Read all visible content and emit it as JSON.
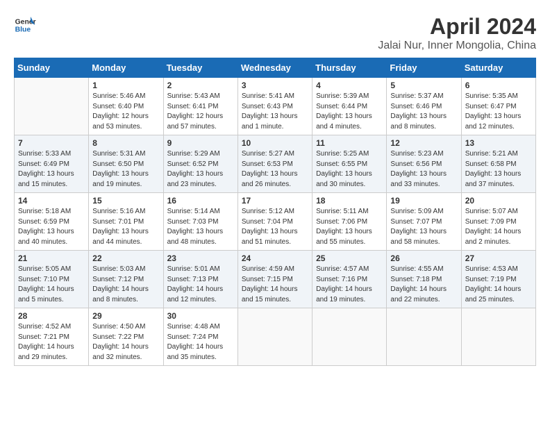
{
  "header": {
    "logo_line1": "General",
    "logo_line2": "Blue",
    "title": "April 2024",
    "subtitle": "Jalai Nur, Inner Mongolia, China"
  },
  "days_of_week": [
    "Sunday",
    "Monday",
    "Tuesday",
    "Wednesday",
    "Thursday",
    "Friday",
    "Saturday"
  ],
  "weeks": [
    [
      {
        "day": "",
        "info": ""
      },
      {
        "day": "1",
        "info": "Sunrise: 5:46 AM\nSunset: 6:40 PM\nDaylight: 12 hours\nand 53 minutes."
      },
      {
        "day": "2",
        "info": "Sunrise: 5:43 AM\nSunset: 6:41 PM\nDaylight: 12 hours\nand 57 minutes."
      },
      {
        "day": "3",
        "info": "Sunrise: 5:41 AM\nSunset: 6:43 PM\nDaylight: 13 hours\nand 1 minute."
      },
      {
        "day": "4",
        "info": "Sunrise: 5:39 AM\nSunset: 6:44 PM\nDaylight: 13 hours\nand 4 minutes."
      },
      {
        "day": "5",
        "info": "Sunrise: 5:37 AM\nSunset: 6:46 PM\nDaylight: 13 hours\nand 8 minutes."
      },
      {
        "day": "6",
        "info": "Sunrise: 5:35 AM\nSunset: 6:47 PM\nDaylight: 13 hours\nand 12 minutes."
      }
    ],
    [
      {
        "day": "7",
        "info": "Sunrise: 5:33 AM\nSunset: 6:49 PM\nDaylight: 13 hours\nand 15 minutes."
      },
      {
        "day": "8",
        "info": "Sunrise: 5:31 AM\nSunset: 6:50 PM\nDaylight: 13 hours\nand 19 minutes."
      },
      {
        "day": "9",
        "info": "Sunrise: 5:29 AM\nSunset: 6:52 PM\nDaylight: 13 hours\nand 23 minutes."
      },
      {
        "day": "10",
        "info": "Sunrise: 5:27 AM\nSunset: 6:53 PM\nDaylight: 13 hours\nand 26 minutes."
      },
      {
        "day": "11",
        "info": "Sunrise: 5:25 AM\nSunset: 6:55 PM\nDaylight: 13 hours\nand 30 minutes."
      },
      {
        "day": "12",
        "info": "Sunrise: 5:23 AM\nSunset: 6:56 PM\nDaylight: 13 hours\nand 33 minutes."
      },
      {
        "day": "13",
        "info": "Sunrise: 5:21 AM\nSunset: 6:58 PM\nDaylight: 13 hours\nand 37 minutes."
      }
    ],
    [
      {
        "day": "14",
        "info": "Sunrise: 5:18 AM\nSunset: 6:59 PM\nDaylight: 13 hours\nand 40 minutes."
      },
      {
        "day": "15",
        "info": "Sunrise: 5:16 AM\nSunset: 7:01 PM\nDaylight: 13 hours\nand 44 minutes."
      },
      {
        "day": "16",
        "info": "Sunrise: 5:14 AM\nSunset: 7:03 PM\nDaylight: 13 hours\nand 48 minutes."
      },
      {
        "day": "17",
        "info": "Sunrise: 5:12 AM\nSunset: 7:04 PM\nDaylight: 13 hours\nand 51 minutes."
      },
      {
        "day": "18",
        "info": "Sunrise: 5:11 AM\nSunset: 7:06 PM\nDaylight: 13 hours\nand 55 minutes."
      },
      {
        "day": "19",
        "info": "Sunrise: 5:09 AM\nSunset: 7:07 PM\nDaylight: 13 hours\nand 58 minutes."
      },
      {
        "day": "20",
        "info": "Sunrise: 5:07 AM\nSunset: 7:09 PM\nDaylight: 14 hours\nand 2 minutes."
      }
    ],
    [
      {
        "day": "21",
        "info": "Sunrise: 5:05 AM\nSunset: 7:10 PM\nDaylight: 14 hours\nand 5 minutes."
      },
      {
        "day": "22",
        "info": "Sunrise: 5:03 AM\nSunset: 7:12 PM\nDaylight: 14 hours\nand 8 minutes."
      },
      {
        "day": "23",
        "info": "Sunrise: 5:01 AM\nSunset: 7:13 PM\nDaylight: 14 hours\nand 12 minutes."
      },
      {
        "day": "24",
        "info": "Sunrise: 4:59 AM\nSunset: 7:15 PM\nDaylight: 14 hours\nand 15 minutes."
      },
      {
        "day": "25",
        "info": "Sunrise: 4:57 AM\nSunset: 7:16 PM\nDaylight: 14 hours\nand 19 minutes."
      },
      {
        "day": "26",
        "info": "Sunrise: 4:55 AM\nSunset: 7:18 PM\nDaylight: 14 hours\nand 22 minutes."
      },
      {
        "day": "27",
        "info": "Sunrise: 4:53 AM\nSunset: 7:19 PM\nDaylight: 14 hours\nand 25 minutes."
      }
    ],
    [
      {
        "day": "28",
        "info": "Sunrise: 4:52 AM\nSunset: 7:21 PM\nDaylight: 14 hours\nand 29 minutes."
      },
      {
        "day": "29",
        "info": "Sunrise: 4:50 AM\nSunset: 7:22 PM\nDaylight: 14 hours\nand 32 minutes."
      },
      {
        "day": "30",
        "info": "Sunrise: 4:48 AM\nSunset: 7:24 PM\nDaylight: 14 hours\nand 35 minutes."
      },
      {
        "day": "",
        "info": ""
      },
      {
        "day": "",
        "info": ""
      },
      {
        "day": "",
        "info": ""
      },
      {
        "day": "",
        "info": ""
      }
    ]
  ]
}
